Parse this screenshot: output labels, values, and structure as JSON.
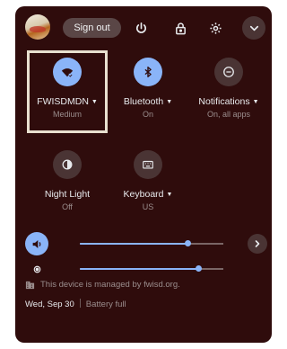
{
  "header": {
    "sign_out_label": "Sign out",
    "icons": [
      "power-icon",
      "lock-icon",
      "gear-icon",
      "chevron-down-icon"
    ]
  },
  "tiles": [
    {
      "label": "FWISDMDN",
      "sub": "Medium",
      "icon": "wifi-icon",
      "active": true
    },
    {
      "label": "Bluetooth",
      "sub": "On",
      "icon": "bluetooth-icon",
      "active": true
    },
    {
      "label": "Notifications",
      "sub": "On, all apps",
      "icon": "notifications-icon",
      "active": false
    },
    {
      "label": "Night Light",
      "sub": "Off",
      "icon": "night-light-icon",
      "active": false
    },
    {
      "label": "Keyboard",
      "sub": "US",
      "icon": "keyboard-icon",
      "active": false
    }
  ],
  "sliders": {
    "volume": {
      "icon": "volume-icon",
      "level": 0.75
    },
    "brightness": {
      "icon": "brightness-icon",
      "level": 0.83
    }
  },
  "managed_text": "This device is managed by fwisd.org.",
  "footer": {
    "date": "Wed, Sep 30",
    "battery": "Battery full"
  },
  "colors": {
    "panel_bg": "#2f0c0c",
    "accent": "#8ab4f8",
    "highlight_border": "#e8e0cf"
  }
}
